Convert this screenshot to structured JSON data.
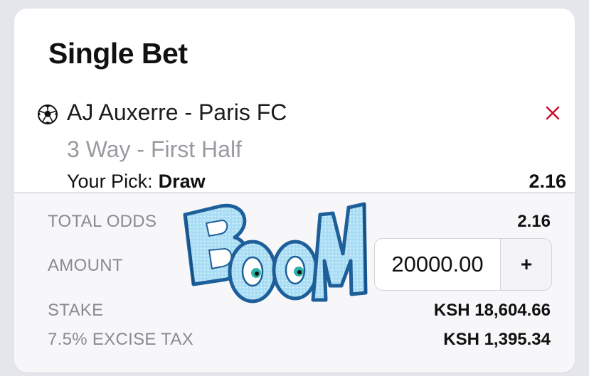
{
  "bet_slip": {
    "title": "Single Bet",
    "match": "AJ Auxerre - Paris FC",
    "market": "3 Way - First Half",
    "pick_label": "Your Pick:",
    "pick_value": "Draw",
    "pick_odds": "2.16"
  },
  "summary": {
    "total_odds_label": "TOTAL ODDS",
    "total_odds_value": "2.16",
    "amount_label": "AMOUNT",
    "amount_value": "20000.00",
    "plus_label": "+",
    "stake_label": "STAKE",
    "stake_value": "KSH 18,604.66",
    "tax_label": "7.5% EXCISE TAX",
    "tax_value": "KSH 1,395.34"
  },
  "sticker": {
    "text": "BOOM"
  },
  "colors": {
    "remove": "#c8102e",
    "sticker_fill": "#9ed8f2",
    "sticker_outline": "#1e5f9a"
  },
  "icons": {
    "ball": "soccer-ball-icon",
    "remove": "close-icon"
  }
}
